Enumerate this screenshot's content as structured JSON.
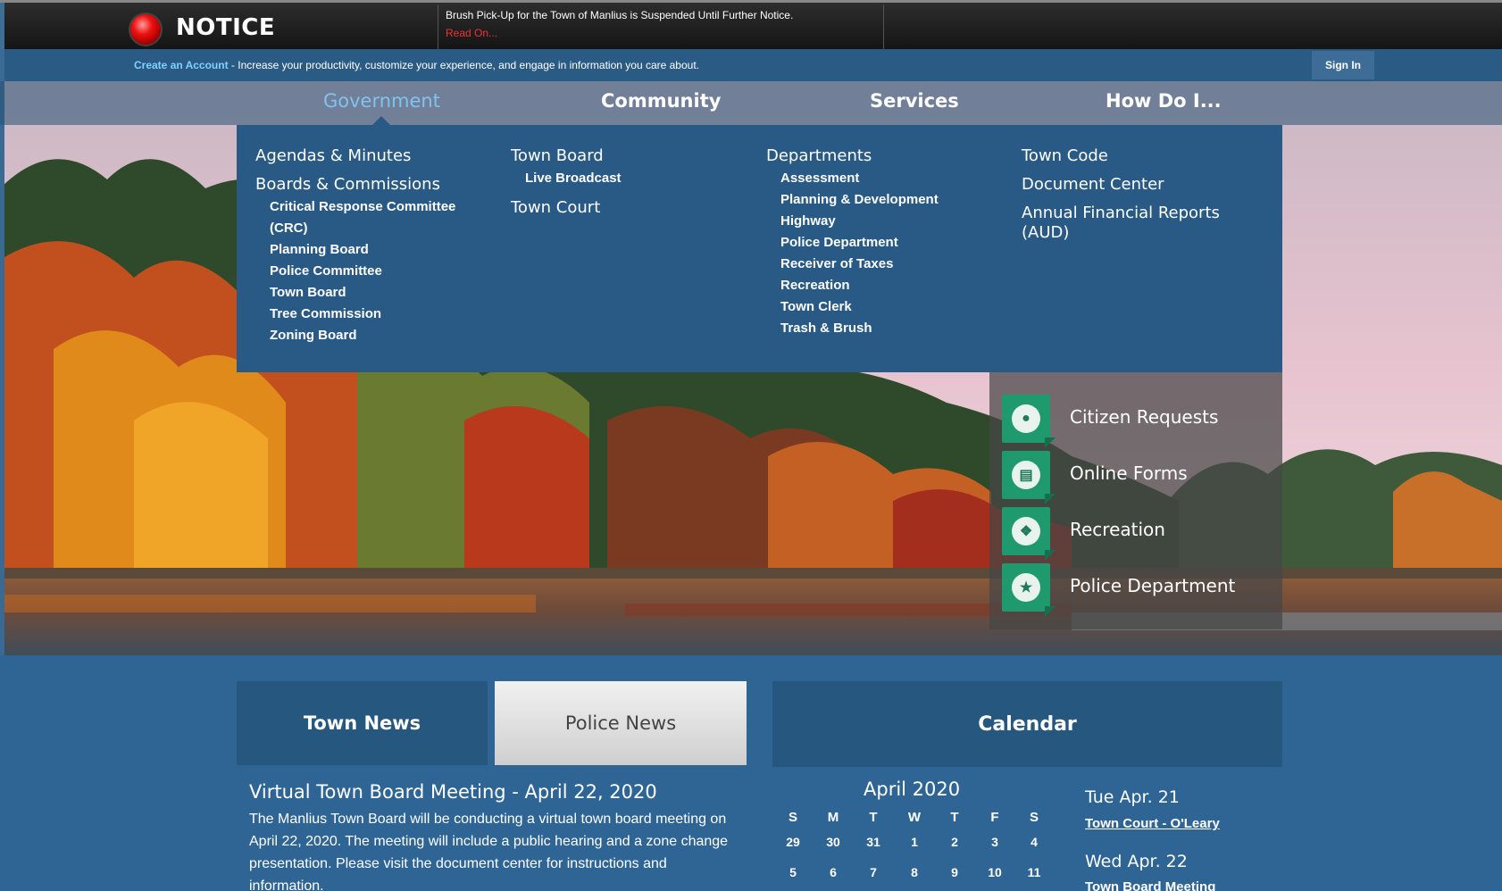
{
  "notice": {
    "title": "NOTICE",
    "message": "Brush Pick-Up for the Town of Manlius is Suspended Until Further Notice.",
    "read_on": "Read On..."
  },
  "account": {
    "create_link": "Create an Account",
    "tagline": " - Increase your productivity, customize your experience, and engage in information you care about.",
    "sign_in": "Sign In"
  },
  "nav": {
    "items": [
      "Government",
      "Community",
      "Services",
      "How Do I..."
    ],
    "active": "Government"
  },
  "mega_menu": {
    "col1": {
      "top1": "Agendas & Minutes",
      "top2": "Boards & Commissions",
      "subs": [
        "Critical Response Committee",
        "(CRC)",
        "Planning Board",
        "Police Committee",
        "Town Board",
        "Tree Commission",
        "Zoning Board"
      ]
    },
    "col2": {
      "top1": "Town Board",
      "sub1": "Live Broadcast",
      "top2": "Town Court"
    },
    "col3": {
      "top1": "Departments",
      "subs": [
        "Assessment",
        "Planning & Development",
        "Highway",
        "Police Department",
        "Receiver of Taxes",
        "Recreation",
        "Town Clerk",
        "Trash & Brush"
      ]
    },
    "col4": {
      "items": [
        "Town Code",
        "Document Center",
        "Annual Financial Reports",
        "(AUD)"
      ]
    }
  },
  "quick_links": [
    {
      "label": "Citizen Requests",
      "icon": "person-icon"
    },
    {
      "label": "Online Forms",
      "icon": "forms-icon"
    },
    {
      "label": "Recreation",
      "icon": "football-icon"
    },
    {
      "label": "Police Department",
      "icon": "police-badge-icon"
    }
  ],
  "tabs": {
    "town_news": "Town News",
    "police_news": "Police News",
    "calendar": "Calendar"
  },
  "news": {
    "title": "Virtual Town Board Meeting - April 22, 2020",
    "body": "The Manlius Town Board will be conducting a virtual town board meeting on April 22, 2020. The meeting will include a public hearing and a zone change presentation. Please visit the document center for instructions and information."
  },
  "calendar": {
    "month": "April 2020",
    "weekdays": [
      "S",
      "M",
      "T",
      "W",
      "T",
      "F",
      "S"
    ],
    "week1": [
      "29",
      "30",
      "31",
      "1",
      "2",
      "3",
      "4"
    ],
    "week2": [
      "5",
      "6",
      "7",
      "8",
      "9",
      "10",
      "11"
    ],
    "events": [
      {
        "date": "Tue Apr. 21",
        "title": "Town Court - O'Leary"
      },
      {
        "date": "Wed Apr. 22",
        "title": "Town Board Meeting"
      }
    ]
  },
  "colors": {
    "accent": "#7fc3ee",
    "menu_bg": "#285a85",
    "tile_green": "#1f9a6e"
  }
}
